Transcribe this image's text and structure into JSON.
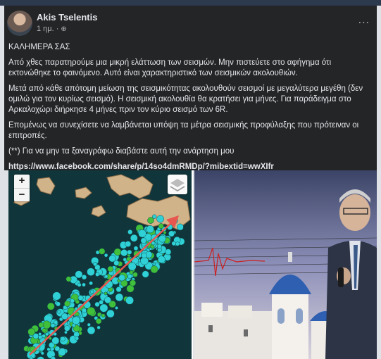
{
  "post": {
    "author": "Akis Tselentis",
    "time": "1 ημ.",
    "more": "...",
    "paragraphs": [
      "ΚΑΛΗΜΕΡΑ ΣΑΣ",
      "Από χθες παρατηρούμε μια μικρή ελάττωση των σεισμών. Μην πιστεύετε στο αφήγημα ότι εκτονώθηκε το φαινόμενο. Αυτό είναι χαρακτηριστικό των σεισμικών ακολουθιών.",
      "Μετά από κάθε απότομη μείωση της σεισμικότητας ακολουθούν σεισμοί με μεγαλύτερα μεγέθη (δεν ομιλώ για τον κυρίως σεισμό). Η σεισμική ακολουθία θα κρατήσει για μήνες. Για παράδειγμα στο Αρκαλοχώρι διήρκησε 4 μήνες πριν τον κύριο σεισμό των 6R.",
      "Επομένως να συνεχίσετε να λαμβάνεται υπόψη τα μέτρα σεισμικής προφύλαξης που πρότειναν οι επιτροπές.",
      "(**) Για να μην τα ξαναγράφω διαβάστε αυτή την ανάρτηση μου"
    ],
    "link": "https://www.facebook.com/share/p/14so4dmRMDp/?mibextid=wwXIfr"
  },
  "map": {
    "zoom_in": "+",
    "zoom_out": "−",
    "layers_icon": "layers-icon"
  },
  "colors": {
    "post_bg": "#242526",
    "quake_cyan": "#2fd1d6",
    "quake_green": "#3fbf3a",
    "arrow": "#e8574f"
  }
}
